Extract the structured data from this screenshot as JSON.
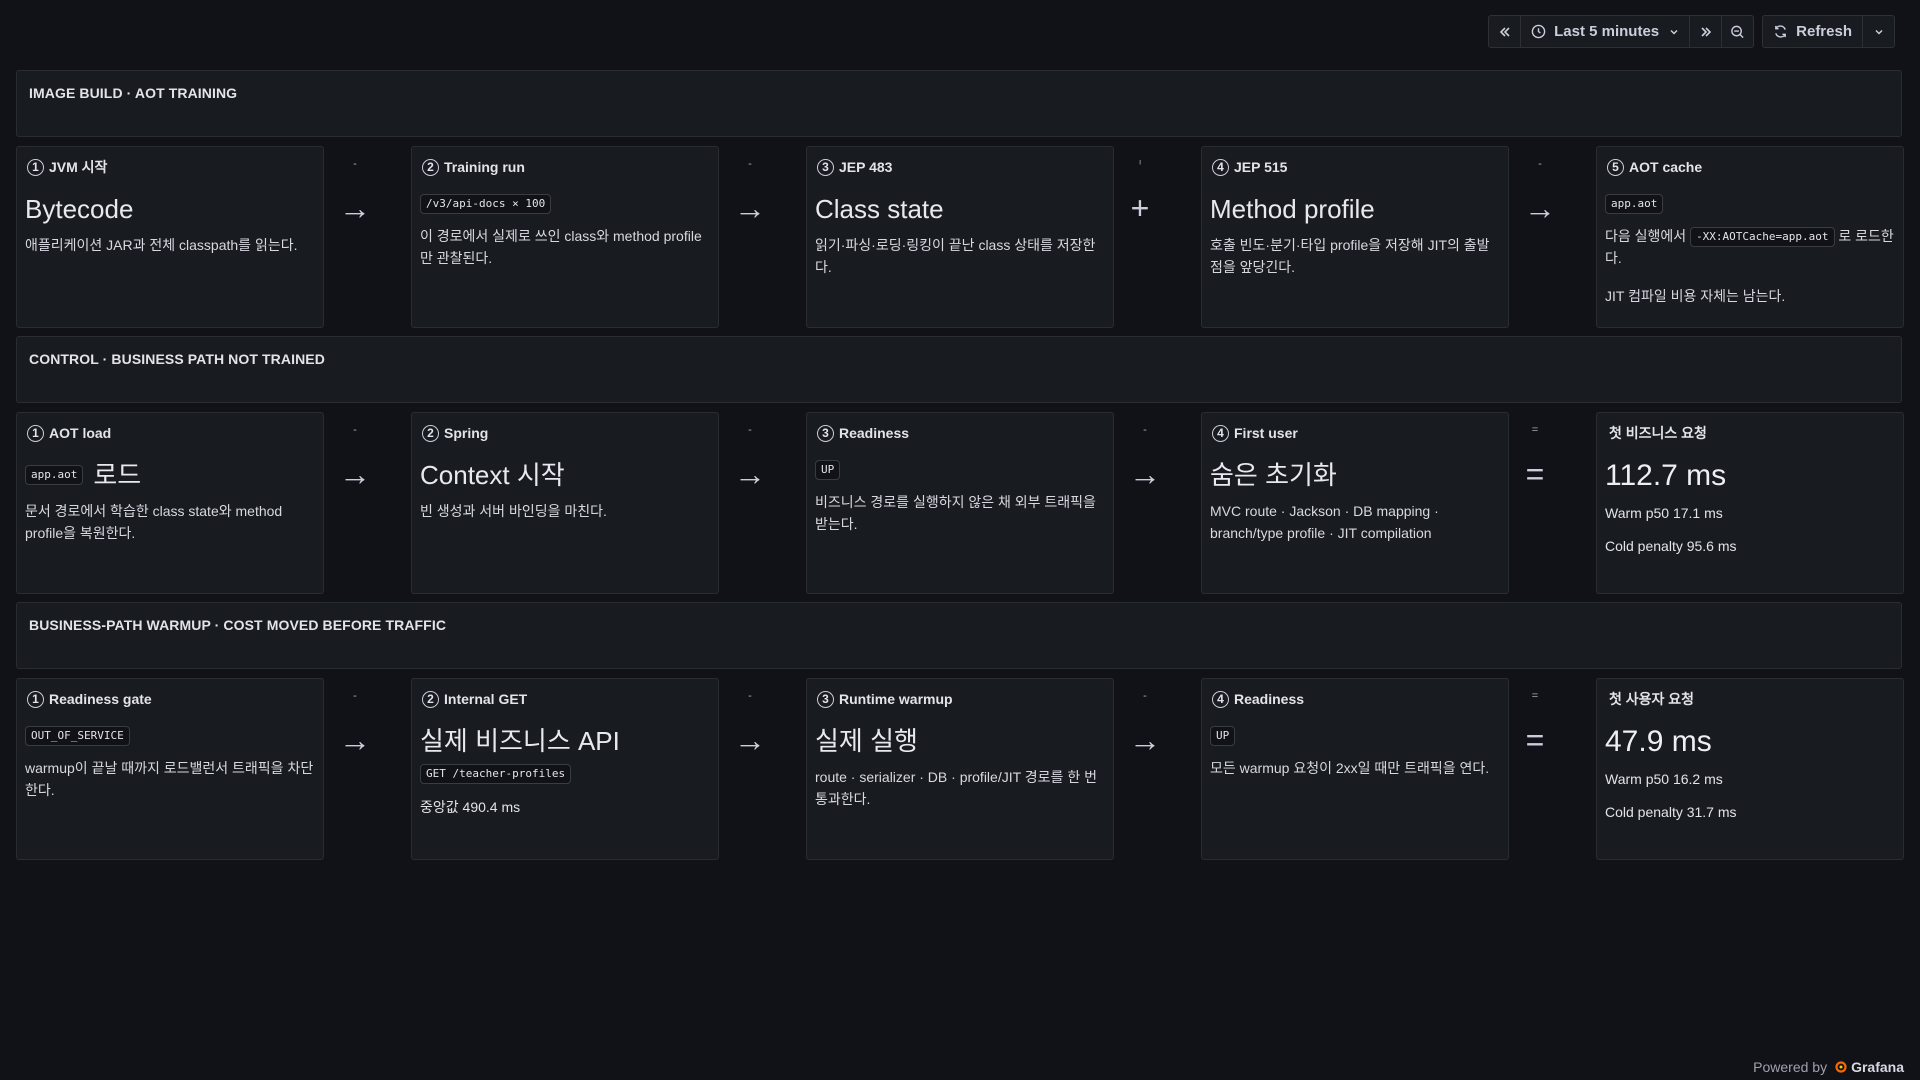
{
  "toolbar": {
    "time_range": "Last 5 minutes",
    "refresh": "Refresh"
  },
  "sections": [
    {
      "title": "IMAGE BUILD · AOT TRAINING"
    },
    {
      "title": "CONTROL · BUSINESS PATH NOT TRAINED"
    },
    {
      "title": "BUSINESS-PATH WARMUP · COST MOVED BEFORE TRAFFIC"
    }
  ],
  "row1": {
    "p1": {
      "num": "1",
      "title": "JVM 시작",
      "big": "Bytecode",
      "desc": "애플리케이션 JAR과 전체 classpath를 읽는다."
    },
    "p2": {
      "num": "2",
      "title": "Training run",
      "code": "/v3/api-docs × 100",
      "desc": "이 경로에서 실제로 쓰인 class와 method profile만 관찰된다."
    },
    "p3": {
      "num": "3",
      "title": "JEP 483",
      "big": "Class state",
      "desc": "읽기·파싱·로딩·링킹이 끝난 class 상태를 저장한다."
    },
    "p4": {
      "num": "4",
      "title": "JEP 515",
      "big": "Method profile",
      "desc": "호출 빈도·분기·타입 profile을 저장해 JIT의 출발점을 앞당긴다."
    },
    "p5": {
      "num": "5",
      "title": "AOT cache",
      "code": "app.aot",
      "desc_pre": "다음 실행에서",
      "desc_code": "-XX:AOTCache=app.aot",
      "desc_post": "로 로드한다.",
      "desc2": "JIT 컴파일 비용 자체는 남는다."
    },
    "ops": [
      {
        "tiny": "-",
        "sym": "→"
      },
      {
        "tiny": "-",
        "sym": "→"
      },
      {
        "tiny": "ᑊ",
        "sym": "+"
      },
      {
        "tiny": "-",
        "sym": "→"
      }
    ]
  },
  "row2": {
    "p1": {
      "num": "1",
      "title": "AOT load",
      "code": "app.aot",
      "big": "로드",
      "desc": "문서 경로에서 학습한 class state와 method profile을 복원한다."
    },
    "p2": {
      "num": "2",
      "title": "Spring",
      "big": "Context 시작",
      "desc": "빈 생성과 서버 바인딩을 마친다."
    },
    "p3": {
      "num": "3",
      "title": "Readiness",
      "code": "UP",
      "desc": "비즈니스 경로를 실행하지 않은 채 외부 트래픽을 받는다."
    },
    "p4": {
      "num": "4",
      "title": "First user",
      "big": "숨은 초기화",
      "desc": "MVC route · Jackson · DB mapping · branch/type profile · JIT compilation"
    },
    "p5": {
      "title": "첫 비즈니스 요청",
      "metric": "112.7 ms",
      "warm": "Warm p50 17.1 ms",
      "cold": "Cold penalty 95.6 ms"
    },
    "ops": [
      {
        "tiny": "-",
        "sym": "→"
      },
      {
        "tiny": "-",
        "sym": "→"
      },
      {
        "tiny": "-",
        "sym": "→"
      },
      {
        "tiny": "=",
        "sym": "="
      }
    ]
  },
  "row3": {
    "p1": {
      "num": "1",
      "title": "Readiness gate",
      "code": "OUT_OF_SERVICE",
      "desc": "warmup이 끝날 때까지 로드밸런서 트래픽을 차단한다."
    },
    "p2": {
      "num": "2",
      "title": "Internal GET",
      "big": "실제 비즈니스 API",
      "code": "GET /teacher-profiles",
      "stat": "중앙값 490.4 ms"
    },
    "p3": {
      "num": "3",
      "title": "Runtime warmup",
      "big": "실제 실행",
      "desc": "route · serializer · DB · profile/JIT 경로를 한 번 통과한다."
    },
    "p4": {
      "num": "4",
      "title": "Readiness",
      "code": "UP",
      "desc": "모든 warmup 요청이 2xx일 때만 트래픽을 연다."
    },
    "p5": {
      "title": "첫 사용자 요청",
      "metric": "47.9 ms",
      "warm": "Warm p50 16.2 ms",
      "cold": "Cold penalty 31.7 ms"
    },
    "ops": [
      {
        "tiny": "-",
        "sym": "→"
      },
      {
        "tiny": "-",
        "sym": "→"
      },
      {
        "tiny": "-",
        "sym": "→"
      },
      {
        "tiny": "=",
        "sym": "="
      }
    ]
  },
  "footer": {
    "powered": "Powered by",
    "brand": "Grafana"
  }
}
